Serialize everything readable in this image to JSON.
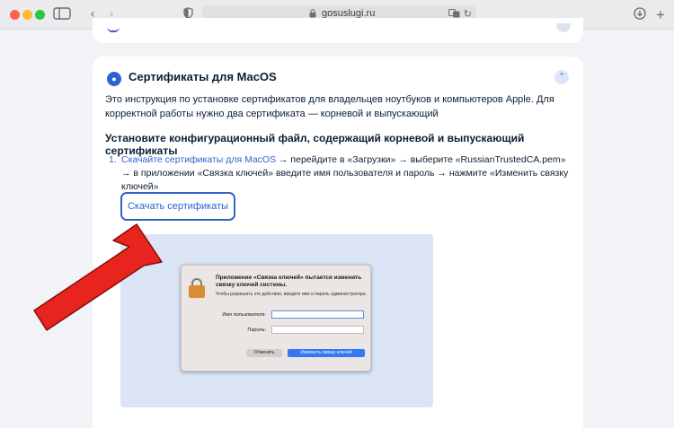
{
  "browser": {
    "url": "gosuslugi.ru",
    "icons": {
      "sidebar": "sidebar-icon",
      "back": "chevron-left-icon",
      "forward": "chevron-right-icon",
      "shield": "privacy-shield-icon",
      "lock": "lock-icon",
      "translate": "translate-icon",
      "reload": "reload-icon",
      "download": "download-icon",
      "new_tab": "plus-icon"
    }
  },
  "card": {
    "title": "Сертификаты для MacOS",
    "intro": "Это инструкция по установке сертификатов для владельцев ноутбуков и компьютеров Apple. Для корректной работы нужно два сертификата — корневой и выпускающий",
    "subheading": "Установите конфигурационный файл, содержащий корневой и выпускающий сертификаты",
    "step": {
      "number": "1.",
      "link_text": "Скачайте сертификаты для MacOS",
      "text": " → перейдите в «Загрузки» → выберите «RussianTrustedCA.pem» → в приложении «Связка ключей» введите имя пользователя и пароль → нажмите «Изменить связку ключей»"
    },
    "download_button": "Скачать сертификаты"
  },
  "dialog": {
    "title": "Приложение «Связка ключей» пытается изменить связку ключей системы.",
    "subtitle": "Чтобы разрешить это действие, введите имя и пароль администратора.",
    "username_label": "Имя пользователя:",
    "password_label": "Пароль:",
    "cancel": "Отменить",
    "confirm": "Изменить связку ключей"
  },
  "colors": {
    "accent": "#2d63d1",
    "arrow": "#e8241e"
  }
}
